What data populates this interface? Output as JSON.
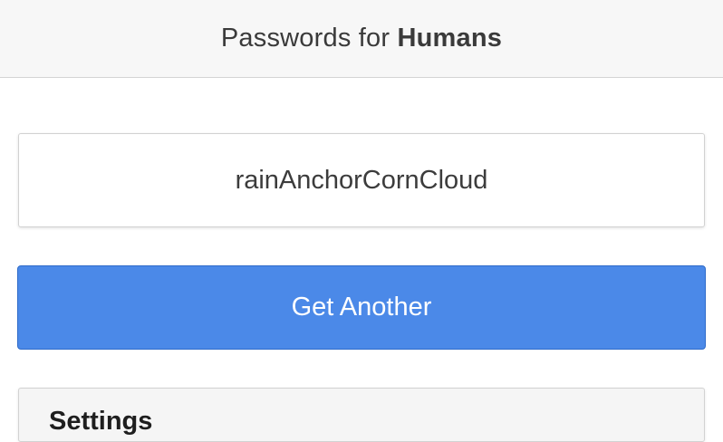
{
  "header": {
    "title_prefix": "Passwords for ",
    "title_strong": "Humans"
  },
  "password": {
    "value": "rainAnchorCornCloud"
  },
  "actions": {
    "get_another_label": "Get Another"
  },
  "settings": {
    "title": "Settings"
  },
  "colors": {
    "header_bg": "#f7f7f7",
    "button_bg": "#4b89e8",
    "button_border": "#2f6bc9",
    "panel_bg": "#f5f5f5"
  }
}
